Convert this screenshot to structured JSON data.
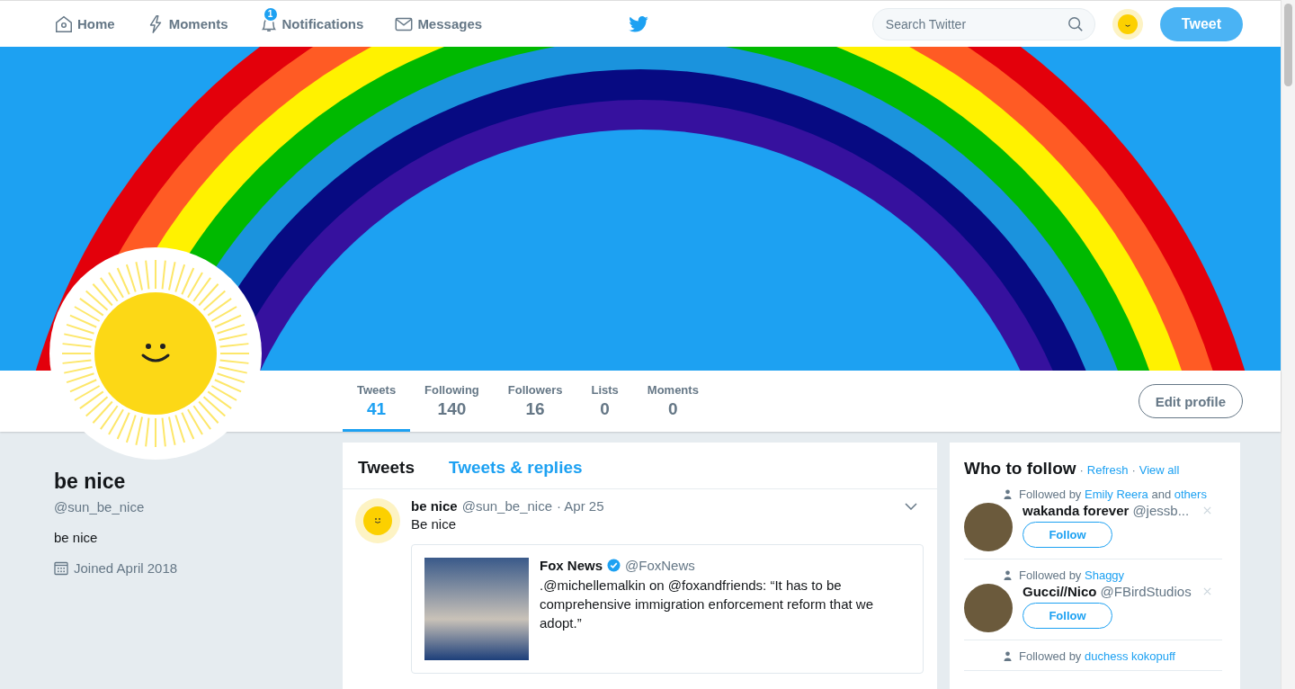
{
  "nav": {
    "items": [
      {
        "label": "Home"
      },
      {
        "label": "Moments"
      },
      {
        "label": "Notifications",
        "badge": "1"
      },
      {
        "label": "Messages"
      }
    ],
    "search": {
      "placeholder": "Search Twitter"
    },
    "tweet_button": "Tweet"
  },
  "stats": [
    {
      "label": "Tweets",
      "value": "41",
      "selected": true
    },
    {
      "label": "Following",
      "value": "140",
      "selected": false
    },
    {
      "label": "Followers",
      "value": "16",
      "selected": false
    },
    {
      "label": "Lists",
      "value": "0",
      "selected": false
    },
    {
      "label": "Moments",
      "value": "0",
      "selected": false
    }
  ],
  "edit_profile": "Edit profile",
  "profile": {
    "name": "be nice",
    "handle": "@sun_be_nice",
    "bio": "be nice",
    "joined": "Joined April 2018"
  },
  "timeline_tabs": [
    {
      "label": "Tweets",
      "selected": true
    },
    {
      "label": "Tweets & replies",
      "selected": false
    }
  ],
  "tweet": {
    "name": "be nice",
    "handle": "@sun_be_nice",
    "date": "· Apr 25",
    "text": "Be nice",
    "quote": {
      "name": "Fox News",
      "verified": true,
      "handle": "@FoxNews",
      "text": ".@michellemalkin on @foxandfriends: “It has to be comprehensive immigration enforcement reform that we adopt.”"
    }
  },
  "who_to_follow": {
    "title": "Who to follow",
    "separator": "·",
    "refresh": "Refresh",
    "view_all": "View all",
    "suggestions": [
      {
        "context": [
          {
            "kind": "text",
            "text": "Followed by"
          },
          {
            "kind": "link",
            "text": "Emily Reera"
          },
          {
            "kind": "text",
            "text": "and"
          },
          {
            "kind": "link",
            "text": "others"
          }
        ],
        "name": "wakanda forever",
        "handle": "@jessb...",
        "follow": "Follow"
      },
      {
        "context": [
          {
            "kind": "text",
            "text": "Followed by"
          },
          {
            "kind": "link",
            "text": "Shaggy"
          }
        ],
        "name": "Gucci//Nico",
        "handle": "@FBirdStudios",
        "follow": "Follow"
      },
      {
        "context": [
          {
            "kind": "text",
            "text": "Followed by"
          },
          {
            "kind": "link",
            "text": "duchess kokopuff"
          }
        ]
      }
    ]
  }
}
